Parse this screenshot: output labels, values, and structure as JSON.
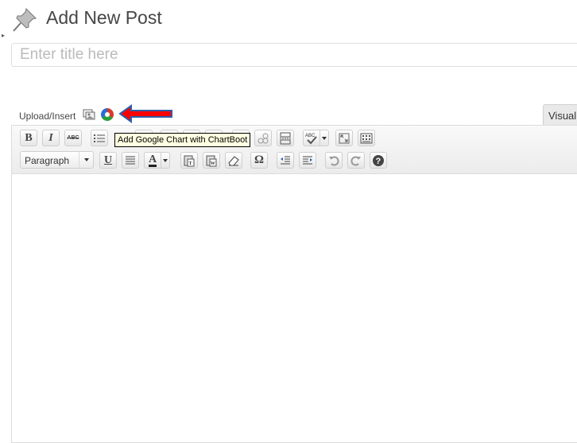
{
  "header": {
    "title": "Add New Post",
    "icon": "pushpin-icon"
  },
  "title_field": {
    "placeholder": "Enter title here",
    "value": ""
  },
  "upload": {
    "label": "Upload/Insert",
    "media_icon": "add-media-icon",
    "chart_icon": "chartboot-chart-icon"
  },
  "tooltip": {
    "text": "Add Google Chart with ChartBoot"
  },
  "tabs": {
    "visual": "Visual"
  },
  "toolbar": {
    "row1": [
      "bold",
      "italic",
      "strikethrough",
      "bullet-list",
      "insert-more-tag",
      "spellcheck",
      "fullscreen",
      "kitchen-sink"
    ],
    "format_select": "Paragraph",
    "row2": [
      "underline",
      "justify",
      "text-color",
      "paste-as-text",
      "paste-from-word",
      "remove-formatting",
      "special-character",
      "outdent",
      "indent",
      "undo",
      "redo",
      "help"
    ],
    "labels": {
      "bold": "B",
      "italic": "I",
      "strike": "ABC",
      "underline": "U",
      "text_color": "A",
      "omega": "Ω",
      "abc": "ABC"
    }
  },
  "colors": {
    "arrow_fill": "#ff0000",
    "arrow_outline": "#2e5fa8",
    "tooltip_bg": "#ffffe1"
  }
}
